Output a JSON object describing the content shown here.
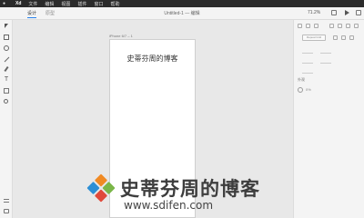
{
  "menubar": {
    "app": "Xd",
    "items": [
      "文件",
      "编辑",
      "视图",
      "插件",
      "窗口",
      "帮助"
    ]
  },
  "topbar": {
    "tabs": [
      "设计",
      "原型"
    ],
    "document_title": "Untitled-1 — 编辑",
    "zoom": "71.2%"
  },
  "tools": [
    "select-tool-icon",
    "rectangle-tool-icon",
    "ellipse-tool-icon",
    "line-tool-icon",
    "pen-tool-icon",
    "text-tool-icon",
    "artboard-tool-icon",
    "zoom-tool-icon"
  ],
  "canvas": {
    "artboard_label": "iPhone 6/7 – 1",
    "artboard_text": "史蒂芬周的博客"
  },
  "panel": {
    "repeat_grid_label": "Repeat Grid",
    "appearance_label": "外观",
    "opacity": "0%"
  },
  "watermark": {
    "title": "史蒂芬周的博客",
    "url": "www.sdifen.com",
    "colors": {
      "orange": "#f08a24",
      "green": "#7ab648",
      "blue": "#2d8fd5",
      "red": "#e04a3b"
    }
  }
}
